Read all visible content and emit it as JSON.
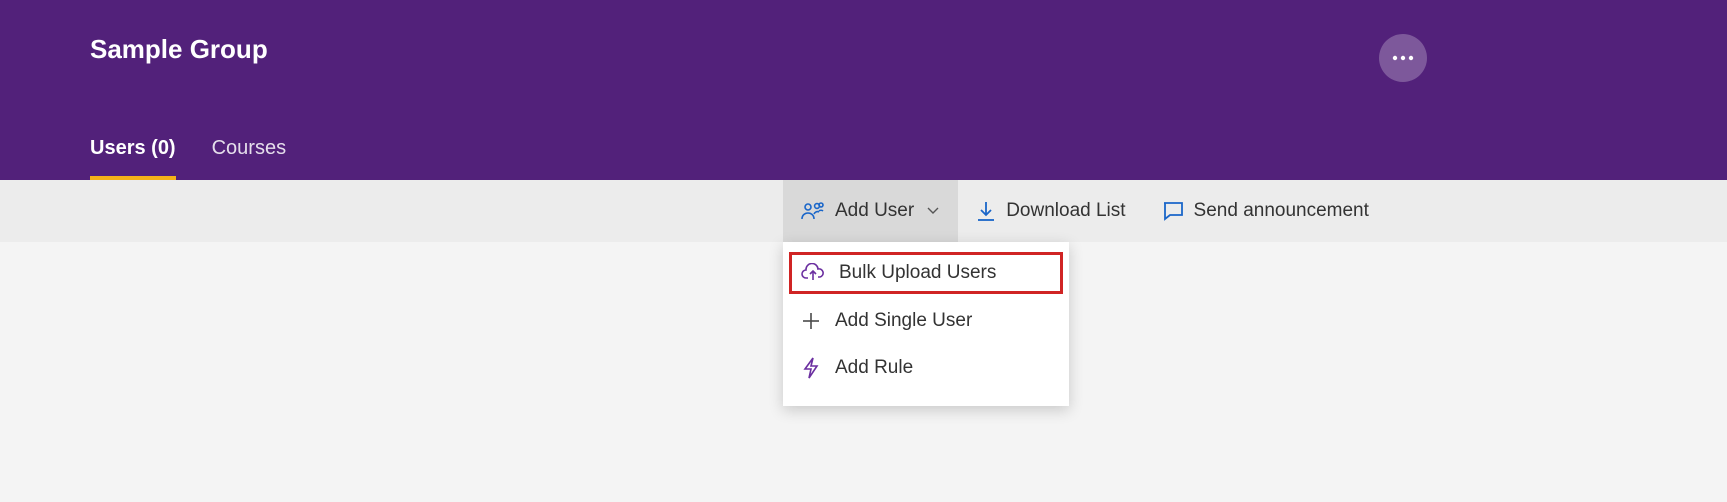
{
  "header": {
    "title": "Sample Group"
  },
  "tabs": {
    "users": "Users (0)",
    "courses": "Courses"
  },
  "toolbar": {
    "add_user": "Add User",
    "download_list": "Download List",
    "send_announcement": "Send announcement"
  },
  "dropdown": {
    "bulk_upload": "Bulk Upload Users",
    "add_single": "Add Single User",
    "add_rule": "Add Rule"
  }
}
